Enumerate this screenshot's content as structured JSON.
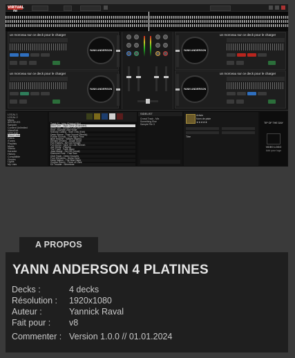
{
  "skin": {
    "logo": "VIRTUAL DJ",
    "deck_title": "un morceau sur ce deck pour le charger",
    "jog_label": "YANN ANDERSON",
    "browser": {
      "folders": [
        "LOCAL 1",
        "LOCAL 2",
        "Mixes",
        "ARCHIVES",
        "Sampler",
        "Content Unlimited",
        "VideoEdit",
        "OFFLINE",
        "Cloud Lists",
        "Filters",
        "iTunes",
        "Playlists",
        "Music",
        "Videos",
        "Karaoke",
        "History",
        "Compatible",
        "Genres",
        "Lights",
        "My Lists"
      ],
      "folder_selected_index": 8,
      "tracks": [
        "Track 01 - Intro (Original Mix)",
        "Artist One - Night Drive (Extended)",
        "Artist Two - Sunset (Club Mix)",
        "Kind - Sounds Like Home",
        "Nobody Calling - Start Only (Edit)",
        "Deep House - Fast Groove (Remix)",
        "Future Sounds - One More Time",
        "Blue Horizon - Waves (Radio)",
        "Electric Dreams - Spark (Dub)",
        "Fun Factory - Be Out Tonight",
        "Fun Doing - Take On Lite (Remix)",
        "Joe Trinity - Playing",
        "The Track - Fade Away",
        "Jean Maine - Set Off (Vocal)",
        "Diamond Rust - Fast Saw",
        "Club Track - Deep Grooves",
        "Four Elements - Alpha Hype",
        "Deep Nation - The Blue Night",
        "Groove Remix - Fever of Light",
        "DJ Trouble - Silvertone"
      ],
      "track_selected_index": 1,
      "sidelist_title": "SIDELIST",
      "sidelist": [
        "Crowd Track - Mix",
        "Something Else",
        "Sample File 3"
      ],
      "info_lines": [
        "Artiste",
        "Nom de piste",
        "Titre"
      ],
      "ad_top": "TIP OF THE DAY",
      "ad_bottom": "VIDEO LOGO",
      "ad_bottom_sub": "Add your logo"
    }
  },
  "about": {
    "tab": "A PROPOS",
    "title": "YANN ANDERSON 4 PLATINES",
    "rows": [
      {
        "label": "Decks :",
        "value": "4 decks"
      },
      {
        "label": "Résolution :",
        "value": "1920x1080"
      },
      {
        "label": "Auteur :",
        "value": "Yannick Raval"
      },
      {
        "label": "Fait pour :",
        "value": "v8"
      },
      {
        "label": "Commenter :",
        "value": "Version 1.0.0 // 01.01.2024"
      }
    ]
  }
}
